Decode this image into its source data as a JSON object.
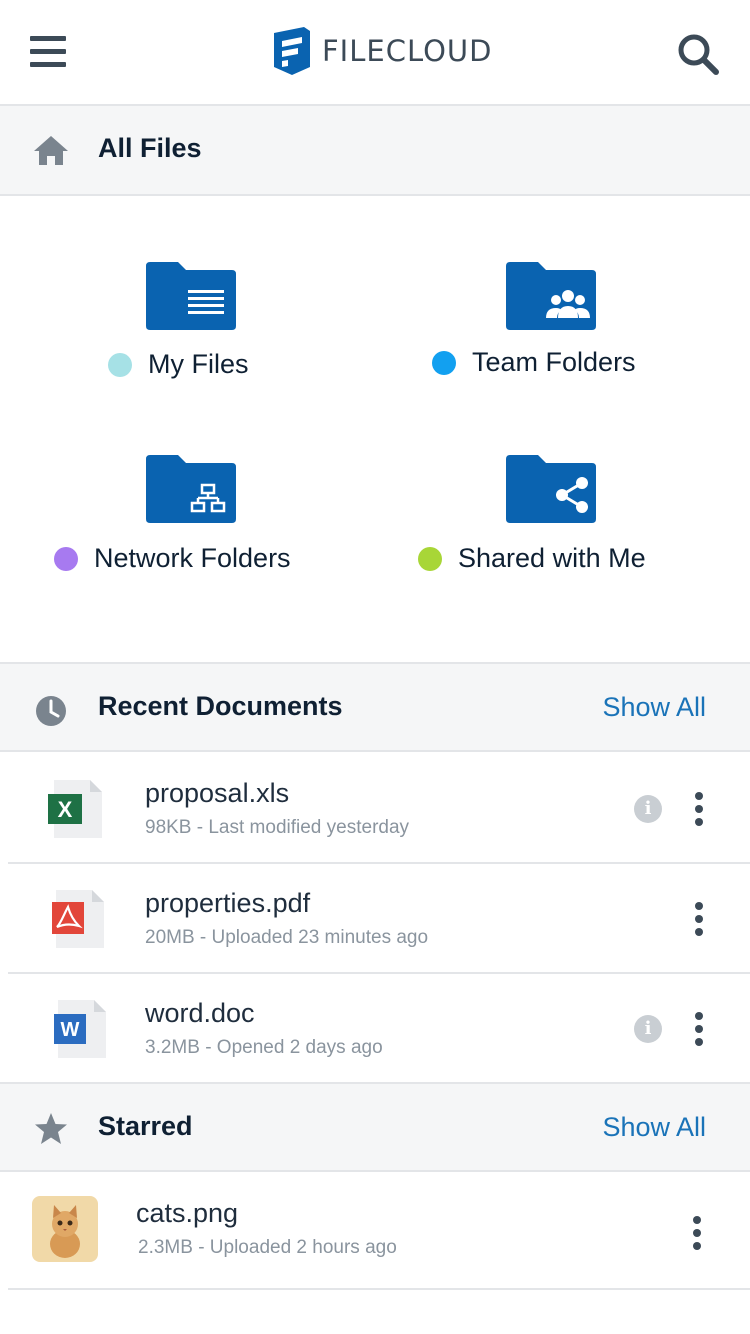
{
  "header": {
    "logo_text": "FILECLOUD"
  },
  "all_files": {
    "title": "All Files"
  },
  "tiles": [
    {
      "label": "My Files",
      "dot_color": "#a6e1e6",
      "icon": "file-list-folder-icon"
    },
    {
      "label": "Team Folders",
      "dot_color": "#12a0f0",
      "icon": "team-folder-icon"
    },
    {
      "label": "Network Folders",
      "dot_color": "#a77af0",
      "icon": "network-folder-icon"
    },
    {
      "label": "Shared with Me",
      "dot_color": "#a8d637",
      "icon": "shared-folder-icon"
    }
  ],
  "recent": {
    "title": "Recent Documents",
    "show_all": "Show All",
    "files": [
      {
        "name": "proposal.xls",
        "meta": "98KB - Last modified yesterday",
        "icon": "excel-file-icon"
      },
      {
        "name": "properties.pdf",
        "meta": "20MB - Uploaded 23 minutes ago",
        "icon": "pdf-file-icon"
      },
      {
        "name": "word.doc",
        "meta": "3.2MB - Opened 2 days ago",
        "icon": "word-file-icon"
      }
    ]
  },
  "starred": {
    "title": "Starred",
    "show_all": "Show All",
    "files": [
      {
        "name": "cats.png",
        "meta": "2.3MB - Uploaded 2 hours ago",
        "icon": "image-thumbnail"
      }
    ]
  },
  "colors": {
    "folder_blue": "#0a63b0",
    "link_blue": "#1a73b8",
    "excel_green": "#1e7145",
    "pdf_red": "#e2463a",
    "word_blue": "#2b6cc0"
  }
}
